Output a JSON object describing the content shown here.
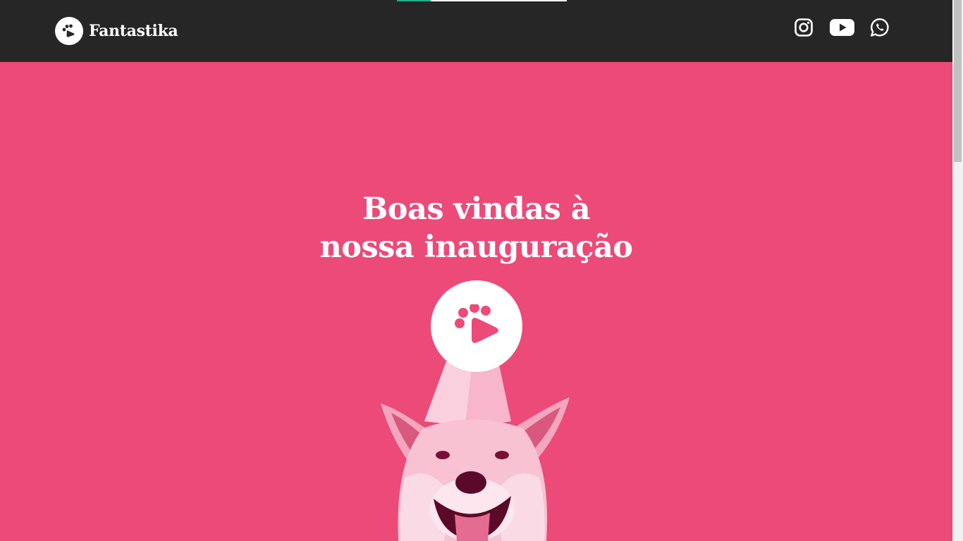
{
  "header": {
    "brand": "Fantastika",
    "progress": 0.2,
    "social": [
      {
        "name": "instagram-icon",
        "label": "Instagram"
      },
      {
        "name": "youtube-icon",
        "label": "YouTube"
      },
      {
        "name": "whatsapp-icon",
        "label": "WhatsApp"
      }
    ]
  },
  "hero": {
    "title_line1": "Boas vindas à",
    "title_line2": "nossa inauguração",
    "play_icon": "paw-play-icon"
  },
  "colors": {
    "header_bg": "#262626",
    "hero_bg": "#ec4a79",
    "accent": "#1fb089",
    "text": "#ffffff"
  },
  "scrollbar": {
    "position": 0
  }
}
